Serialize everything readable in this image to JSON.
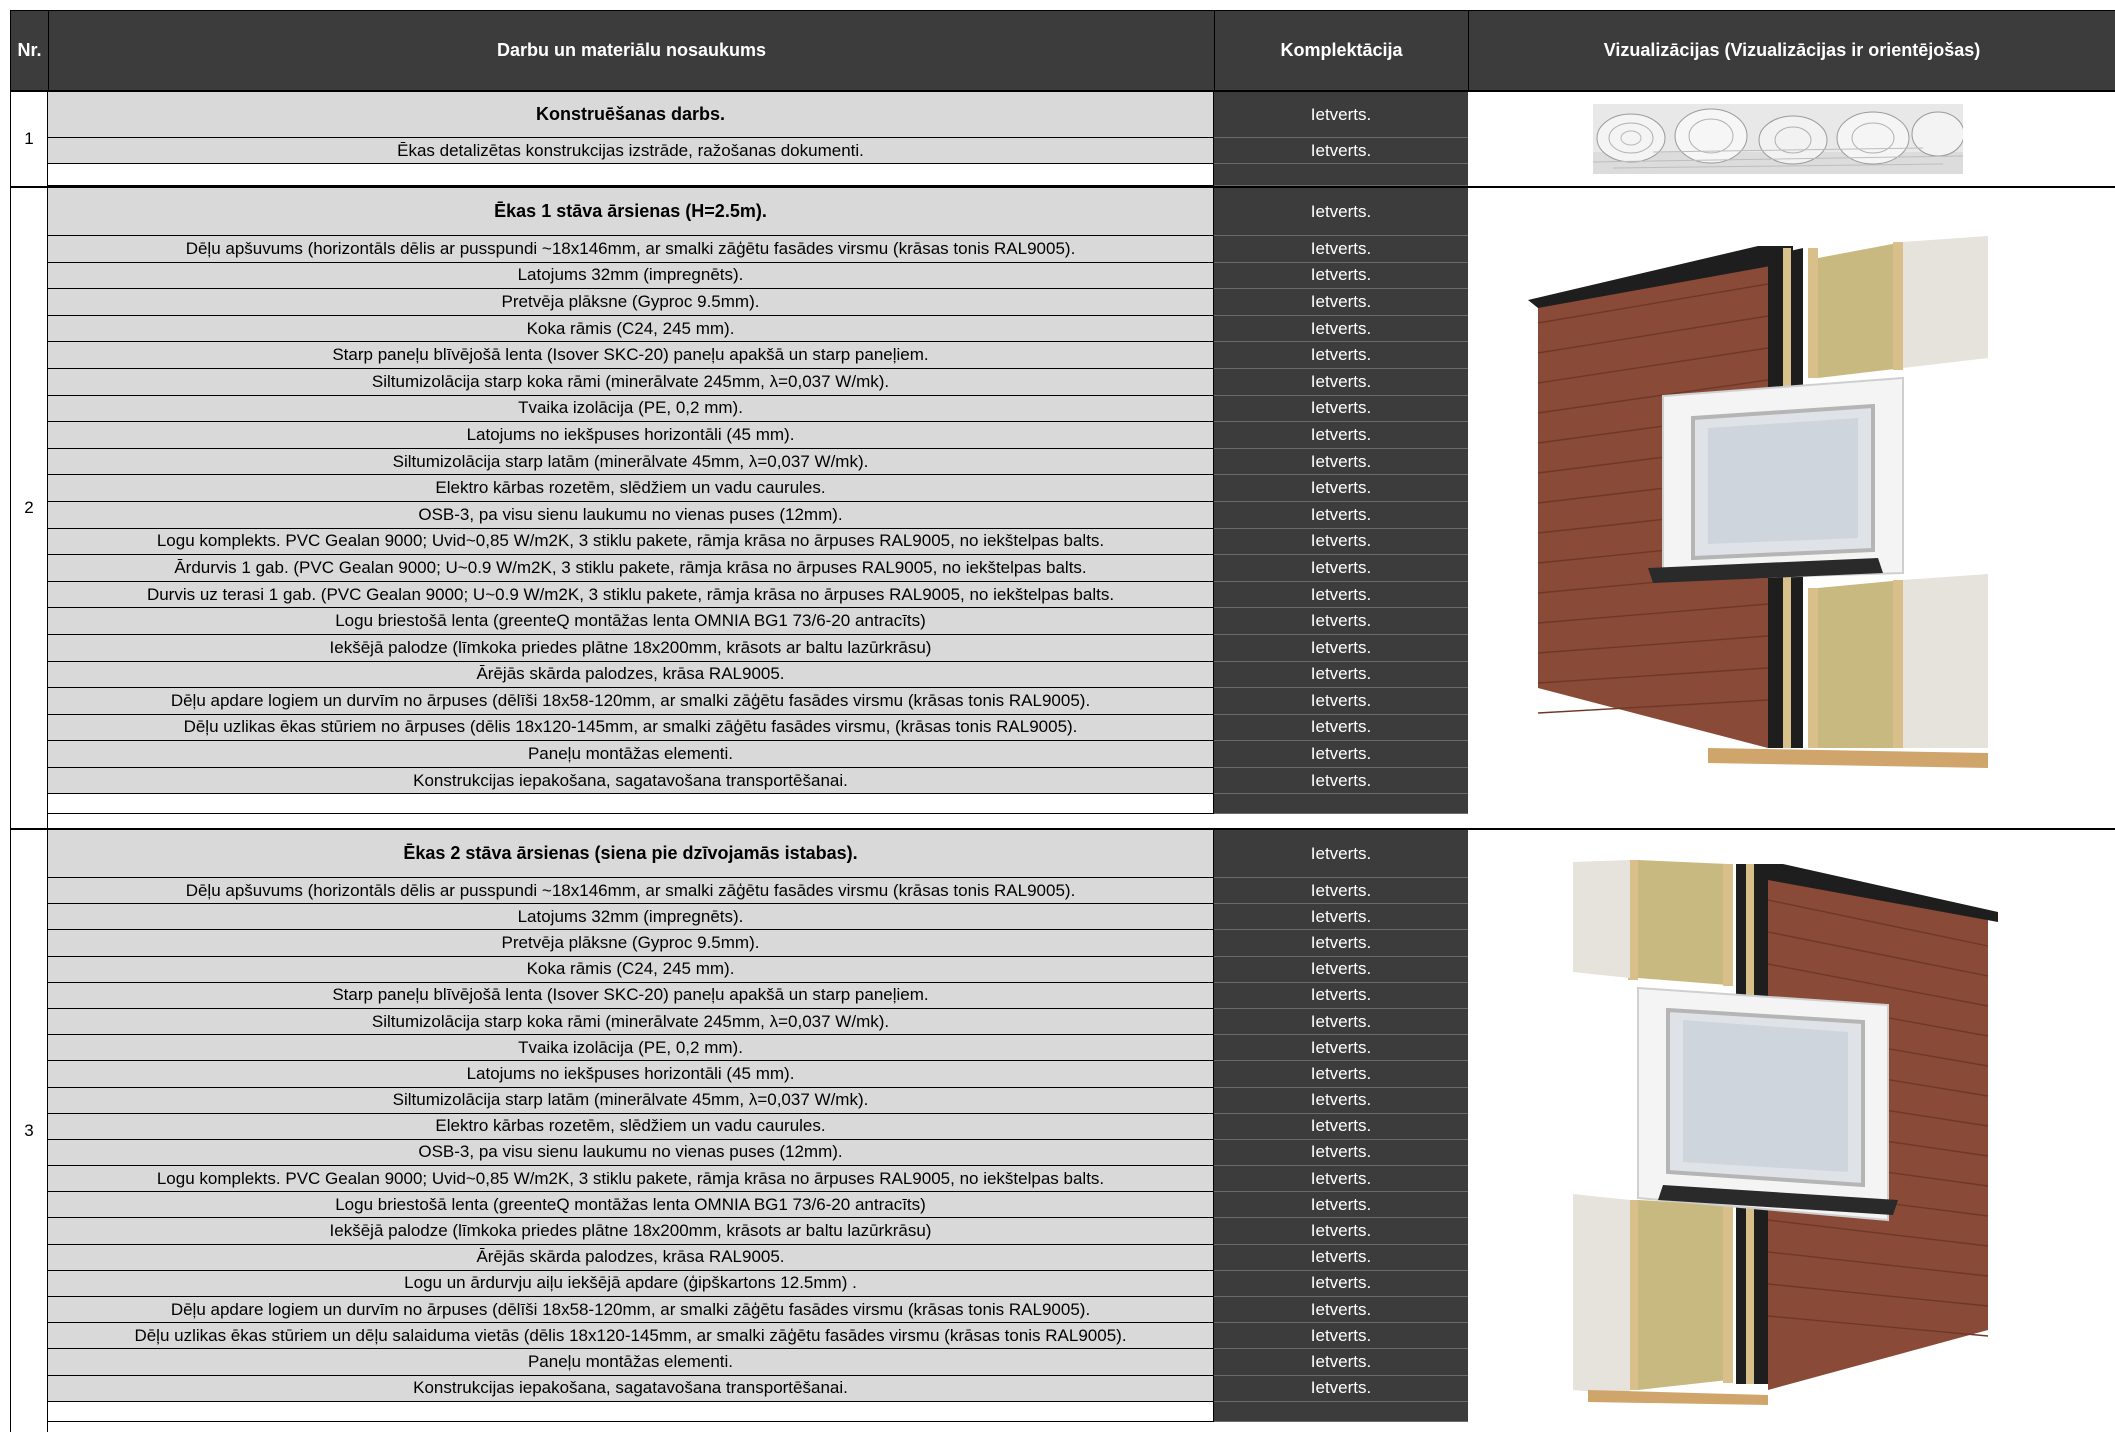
{
  "header": {
    "nr": "Nr.",
    "name": "Darbu un materiālu nosaukums",
    "komplektacija": "Komplektācija",
    "vizualizacijas": "Vizualizācijas (Vizualizācijas ir orientējošas)"
  },
  "sections": [
    {
      "nr": "1",
      "title": "Konstruēšanas darbs.",
      "title_status": "Ietverts.",
      "items": [
        {
          "name": "Ēkas detalizētas konstrukcijas izstrāde, ražošanas dokumenti.",
          "status": "Ietverts."
        }
      ],
      "image": "blueprints-image"
    },
    {
      "nr": "2",
      "title": "Ēkas 1 stāva ārsienas (H=2.5m).",
      "title_status": "Ietverts.",
      "items": [
        {
          "name": "Dēļu apšuvums (horizontāls dēlis ar pusspundi ~18x146mm, ar smalki zāģētu fasādes virsmu (krāsas tonis RAL9005).",
          "status": "Ietverts."
        },
        {
          "name": "Latojums 32mm (impregnēts).",
          "status": "Ietverts."
        },
        {
          "name": "Pretvēja plāksne (Gyproc 9.5mm).",
          "status": "Ietverts."
        },
        {
          "name": "Koka rāmis (C24, 245 mm).",
          "status": "Ietverts."
        },
        {
          "name": "Starp paneļu blīvējošā lenta (Isover SKC-20) paneļu apakšā un starp paneļiem.",
          "status": "Ietverts."
        },
        {
          "name": "Siltumizolācija starp koka rāmi (minerālvate 245mm,  λ=0,037 W/mk).",
          "status": "Ietverts."
        },
        {
          "name": "Tvaika izolācija (PE, 0,2 mm).",
          "status": "Ietverts."
        },
        {
          "name": "Latojums no iekšpuses horizontāli  (45 mm).",
          "status": "Ietverts."
        },
        {
          "name": "Siltumizolācija starp latām (minerālvate 45mm,  λ=0,037 W/mk).",
          "status": "Ietverts."
        },
        {
          "name": "Elektro kārbas rozetēm, slēdžiem un vadu caurules.",
          "status": "Ietverts."
        },
        {
          "name": "OSB-3, pa visu sienu laukumu no vienas puses (12mm).",
          "status": "Ietverts."
        },
        {
          "name": "Logu komplekts. PVC Gealan 9000; Uvid~0,85 W/m2K, 3 stiklu pakete, rāmja krāsa no ārpuses RAL9005, no iekštelpas balts.",
          "status": "Ietverts."
        },
        {
          "name": "Ārdurvis 1 gab. (PVC Gealan 9000; U~0.9 W/m2K, 3 stiklu pakete, rāmja krāsa no ārpuses RAL9005, no iekštelpas balts.",
          "status": "Ietverts."
        },
        {
          "name": "Durvis uz terasi 1 gab. (PVC Gealan 9000; U~0.9 W/m2K, 3 stiklu pakete, rāmja krāsa no ārpuses RAL9005, no iekštelpas balts.",
          "status": "Ietverts."
        },
        {
          "name": "Logu briestošā lenta (greenteQ montāžas lenta OMNIA BG1 73/6-20 antracīts)",
          "status": "Ietverts."
        },
        {
          "name": "Iekšējā palodze (līmkoka priedes plātne 18x200mm, krāsots ar baltu lazūrkrāsu)",
          "status": "Ietverts."
        },
        {
          "name": "Ārējās skārda palodzes, krāsa  RAL9005.",
          "status": "Ietverts."
        },
        {
          "name": "Dēļu apdare logiem un durvīm no ārpuses (dēlīši 18x58-120mm, ar smalki zāģētu fasādes virsmu  (krāsas tonis RAL9005).",
          "status": "Ietverts."
        },
        {
          "name": "Dēļu uzlikas ēkas stūriem no ārpuses (dēlis 18x120-145mm, ar smalki zāģētu fasādes virsmu, (krāsas tonis RAL9005).",
          "status": "Ietverts."
        },
        {
          "name": "Paneļu montāžas elementi.",
          "status": "Ietverts."
        },
        {
          "name": "Konstrukcijas iepakošana, sagatavošana transportēšanai.",
          "status": "Ietverts."
        }
      ],
      "image": "wall-section-right-image"
    },
    {
      "nr": "3",
      "title": "Ēkas 2 stāva ārsienas (siena pie dzīvojamās istabas).",
      "title_status": "Ietverts.",
      "items": [
        {
          "name": "Dēļu apšuvums (horizontāls dēlis ar pusspundi ~18x146mm, ar smalki zāģētu fasādes virsmu  (krāsas tonis RAL9005).",
          "status": "Ietverts."
        },
        {
          "name": "Latojums 32mm (impregnēts).",
          "status": "Ietverts."
        },
        {
          "name": "Pretvēja plāksne (Gyproc 9.5mm).",
          "status": "Ietverts."
        },
        {
          "name": "Koka rāmis (C24, 245 mm).",
          "status": "Ietverts."
        },
        {
          "name": "Starp paneļu blīvējošā lenta (Isover SKC-20) paneļu apakšā un starp paneļiem.",
          "status": "Ietverts."
        },
        {
          "name": "Siltumizolācija starp koka rāmi (minerālvate 245mm,  λ=0,037 W/mk).",
          "status": "Ietverts."
        },
        {
          "name": "Tvaika izolācija (PE, 0,2 mm).",
          "status": "Ietverts."
        },
        {
          "name": "Latojums no iekšpuses horizontāli  (45 mm).",
          "status": "Ietverts."
        },
        {
          "name": "Siltumizolācija starp latām (minerālvate 45mm,  λ=0,037 W/mk).",
          "status": "Ietverts."
        },
        {
          "name": "Elektro kārbas rozetēm, slēdžiem un vadu caurules.",
          "status": "Ietverts."
        },
        {
          "name": "OSB-3, pa visu sienu laukumu no vienas puses (12mm).",
          "status": "Ietverts."
        },
        {
          "name": "Logu komplekts. PVC Gealan 9000; Uvid~0,85 W/m2K, 3 stiklu pakete, rāmja krāsa no ārpuses RAL9005, no iekštelpas balts.",
          "status": "Ietverts."
        },
        {
          "name": "Logu briestošā lenta (greenteQ montāžas lenta OMNIA BG1 73/6-20 antracīts)",
          "status": "Ietverts."
        },
        {
          "name": "Iekšējā palodze (līmkoka priedes plātne 18x200mm, krāsots ar baltu lazūrkrāsu)",
          "status": "Ietverts."
        },
        {
          "name": "Ārējās skārda palodzes, krāsa  RAL9005.",
          "status": "Ietverts."
        },
        {
          "name": "Logu un ārdurvju aiļu iekšējā apdare (ģipškartons 12.5mm) .",
          "status": "Ietverts."
        },
        {
          "name": "Dēļu apdare logiem un durvīm no ārpuses (dēlīši 18x58-120mm, ar smalki zāģētu fasādes virsmu  (krāsas tonis RAL9005).",
          "status": "Ietverts."
        },
        {
          "name": "Dēļu uzlikas ēkas stūriem un dēļu salaiduma vietās (dēlis 18x120-145mm, ar smalki zāģētu fasādes virsmu  (krāsas tonis RAL9005).",
          "status": "Ietverts."
        },
        {
          "name": "Paneļu montāžas elementi.",
          "status": "Ietverts."
        },
        {
          "name": "Konstrukcijas iepakošana, sagatavošana transportēšanai.",
          "status": "Ietverts."
        }
      ],
      "image": "wall-section-left-image"
    }
  ]
}
